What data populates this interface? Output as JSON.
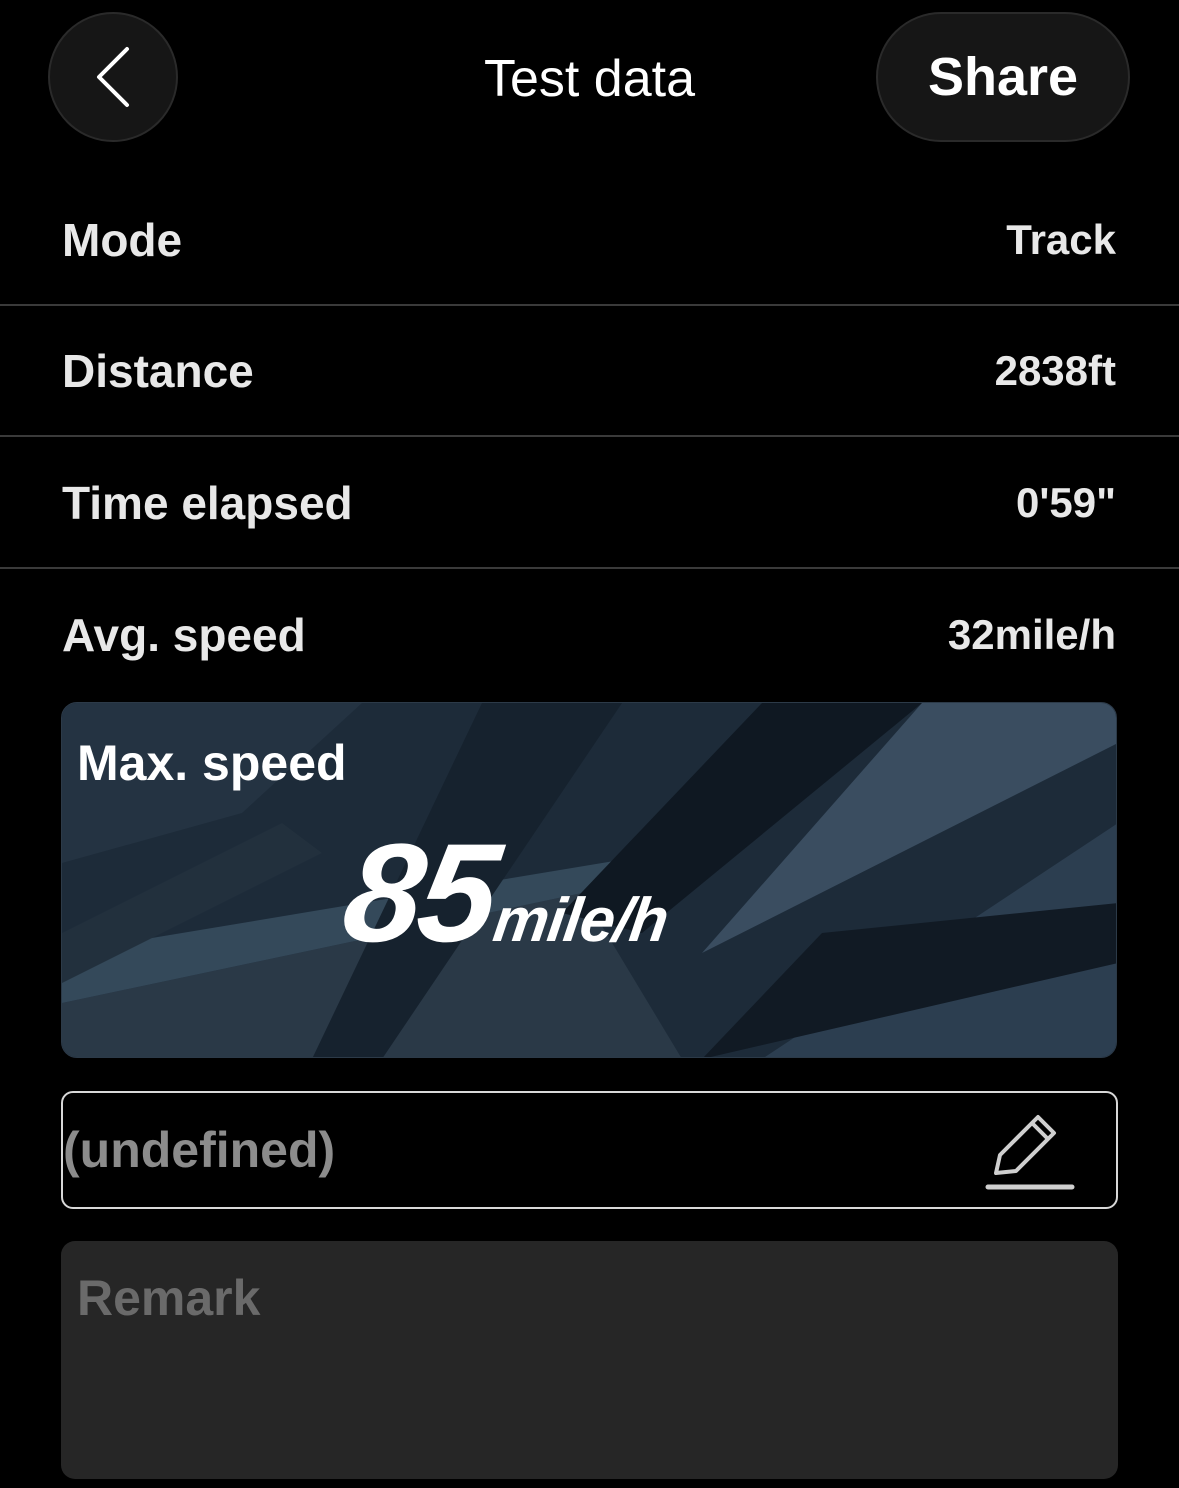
{
  "header": {
    "back_icon": "chevron-left-icon",
    "title": "Test data",
    "share_label": "Share"
  },
  "stats": [
    {
      "label": "Mode",
      "value": "Track"
    },
    {
      "label": "Distance",
      "value": "2838ft"
    },
    {
      "label": "Time elapsed",
      "value": "0'59\""
    },
    {
      "label": "Avg. speed",
      "value": "32mile/h"
    }
  ],
  "max_speed": {
    "label": "Max. speed",
    "value": "85",
    "unit": "mile/h"
  },
  "name_field": {
    "value": "(undefined)",
    "edit_icon": "pencil-icon"
  },
  "remark": {
    "placeholder": "Remark",
    "value": ""
  },
  "colors": {
    "background": "#000000",
    "card_background": "#1c2a38",
    "text_primary": "#ffffff",
    "text_muted": "#8c8c8c",
    "remark_background": "#262626"
  }
}
